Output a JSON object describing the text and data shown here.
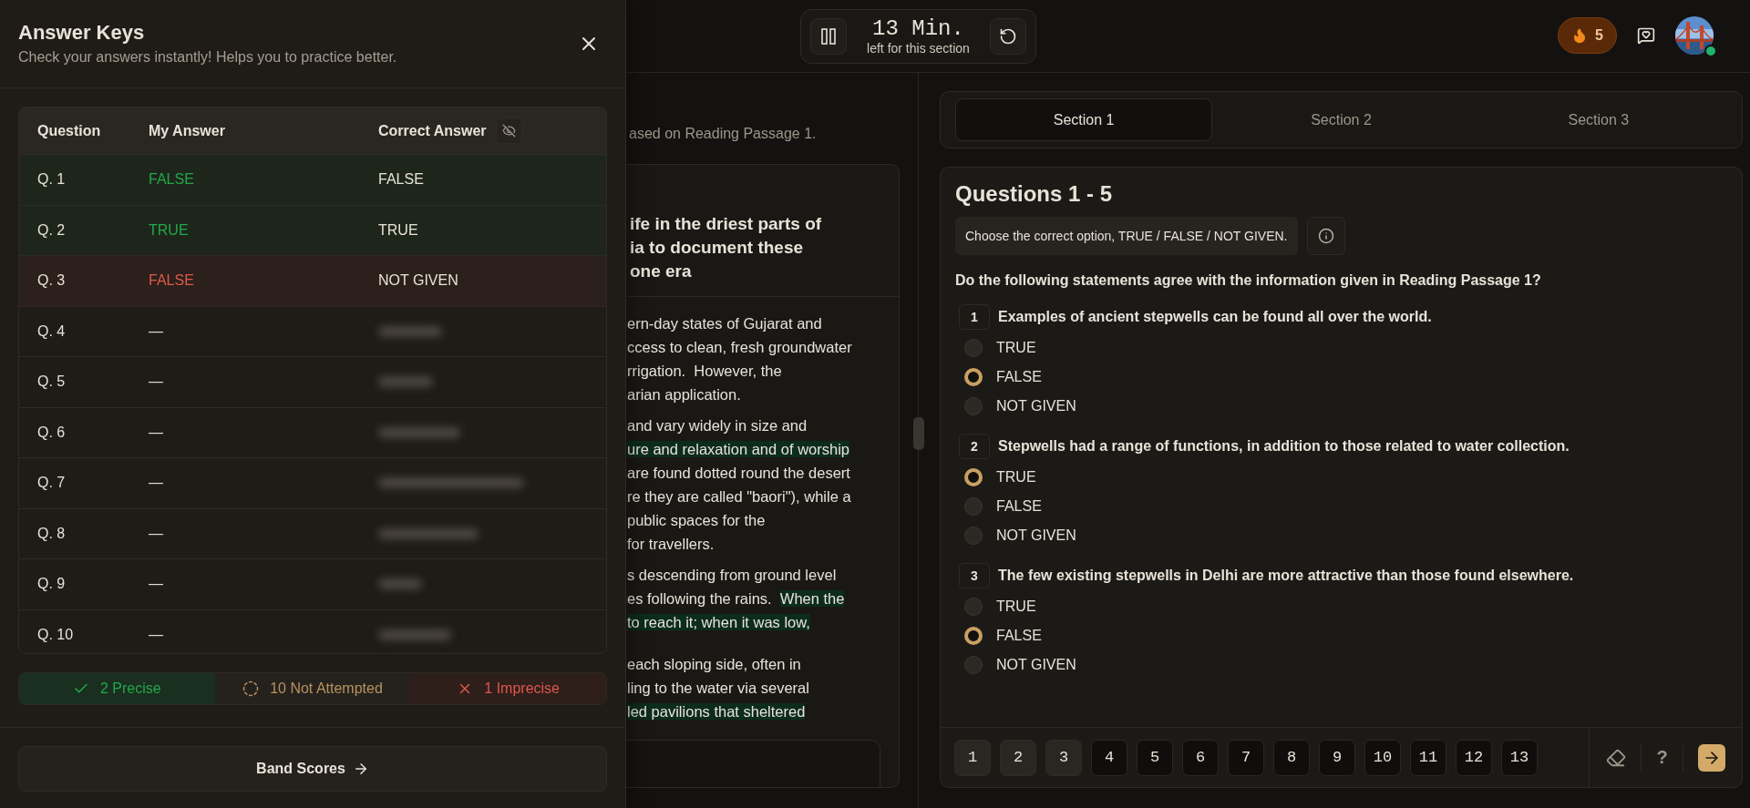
{
  "timer": {
    "time": "13 Min.",
    "caption": "left for this section"
  },
  "header": {
    "streak": "5"
  },
  "drawer": {
    "title": "Answer Keys",
    "subtitle": "Check your answers instantly! Helps you to practice better.",
    "columns": [
      "Question",
      "My Answer",
      "Correct Answer"
    ],
    "rows": [
      {
        "question": "Q. 1",
        "mine": "FALSE",
        "correct": "FALSE",
        "attempted": true,
        "accurate": true,
        "hidden": false
      },
      {
        "question": "Q. 2",
        "mine": "TRUE",
        "correct": "TRUE",
        "attempted": true,
        "accurate": true,
        "hidden": false
      },
      {
        "question": "Q. 3",
        "mine": "FALSE",
        "correct": "NOT GIVEN",
        "attempted": true,
        "accurate": false,
        "hidden": false
      },
      {
        "question": "Q. 4",
        "mine": "—",
        "attempted": false,
        "hidden": true
      },
      {
        "question": "Q. 5",
        "mine": "—",
        "attempted": false,
        "hidden": true
      },
      {
        "question": "Q. 6",
        "mine": "—",
        "attempted": false,
        "hidden": true
      },
      {
        "question": "Q. 7",
        "mine": "—",
        "attempted": false,
        "hidden": true
      },
      {
        "question": "Q. 8",
        "mine": "—",
        "attempted": false,
        "hidden": true
      },
      {
        "question": "Q. 9",
        "mine": "—",
        "attempted": false,
        "hidden": true
      },
      {
        "question": "Q. 10",
        "mine": "—",
        "attempted": false,
        "hidden": true
      }
    ],
    "summary": [
      {
        "kind": "precise",
        "label": "2 Precise"
      },
      {
        "kind": "not_attempted",
        "label": "10 Not Attempted"
      },
      {
        "kind": "imprecise",
        "label": "1 Imprecise"
      }
    ],
    "button": "Band Scores"
  },
  "passage": {
    "instruction": "ased on Reading Passage 1.",
    "heading": [
      "ife in the driest parts of",
      "ia to document these",
      "one era"
    ],
    "paragraphs": [
      [
        [
          {
            "text": "ern-day states of Gujarat and",
            "highlighted": false
          }
        ],
        [
          {
            "text": "ccess to clean, fresh groundwater",
            "highlighted": false
          }
        ],
        [
          {
            "text": "rrigation.  However, the",
            "highlighted": false
          }
        ],
        [
          {
            "text": "arian application.",
            "highlighted": false
          }
        ]
      ],
      [
        [
          {
            "text": "and vary widely in size and",
            "highlighted": false
          }
        ],
        [
          {
            "text": "ure and relaxation and of worship",
            "highlighted": true
          }
        ],
        [
          {
            "text": "are found dotted round the desert",
            "highlighted": false
          }
        ],
        [
          {
            "text": "re they are called \"baori\"), while a",
            "highlighted": false
          }
        ],
        [
          {
            "text": "public spaces for the",
            "highlighted": false
          }
        ],
        [
          {
            "text": "for travellers.",
            "highlighted": false
          }
        ]
      ],
      [
        [
          {
            "text": "s descending from ground level",
            "highlighted": false
          }
        ],
        [
          {
            "text": "es following the rains.  ",
            "highlighted": false
          },
          {
            "text": "When the",
            "highlighted": true
          }
        ],
        [
          {
            "text": "to reach it; when it was low,",
            "highlighted": true
          }
        ]
      ],
      [
        [
          {
            "text": "each sloping side, often in",
            "highlighted": false
          }
        ],
        [
          {
            "text": "ling to the water via several",
            "highlighted": false
          }
        ],
        [
          {
            "text": "led pavilions that sheltered",
            "highlighted": true
          }
        ]
      ]
    ]
  },
  "sections": [
    {
      "label": "Section 1",
      "selected": true
    },
    {
      "label": "Section 2",
      "selected": false
    },
    {
      "label": "Section 3",
      "selected": false
    }
  ],
  "questions": {
    "title": "Questions 1 - 5",
    "instruction": "Choose the correct option, TRUE / FALSE / NOT GIVEN.",
    "prompt": "Do the following statements agree with the information given in Reading Passage 1?",
    "items": [
      {
        "number": "1",
        "text": "Examples of ancient stepwells can be found all over the world.",
        "options": [
          {
            "label": "TRUE",
            "selected": false
          },
          {
            "label": "FALSE",
            "selected": true
          },
          {
            "label": "NOT GIVEN",
            "selected": false
          }
        ]
      },
      {
        "number": "2",
        "text": "Stepwells had a range of functions, in addition to those related to water collection.",
        "options": [
          {
            "label": "TRUE",
            "selected": true
          },
          {
            "label": "FALSE",
            "selected": false
          },
          {
            "label": "NOT GIVEN",
            "selected": false
          }
        ]
      },
      {
        "number": "3",
        "text": "The few existing stepwells in Delhi are more attractive than those found elsewhere.",
        "options": [
          {
            "label": "TRUE",
            "selected": false
          },
          {
            "label": "FALSE",
            "selected": true
          },
          {
            "label": "NOT GIVEN",
            "selected": false
          }
        ]
      }
    ]
  },
  "nav": {
    "tools_help": "?",
    "pages": [
      {
        "label": "1",
        "answered": true
      },
      {
        "label": "2",
        "answered": true
      },
      {
        "label": "3",
        "answered": true
      },
      {
        "label": "4",
        "answered": false
      },
      {
        "label": "5",
        "answered": false
      },
      {
        "label": "6",
        "answered": false
      },
      {
        "label": "7",
        "answered": false
      },
      {
        "label": "8",
        "answered": false
      },
      {
        "label": "9",
        "answered": false
      },
      {
        "label": "10",
        "answered": false
      },
      {
        "label": "11",
        "answered": false
      },
      {
        "label": "12",
        "answered": false
      },
      {
        "label": "13",
        "answered": false
      }
    ]
  }
}
